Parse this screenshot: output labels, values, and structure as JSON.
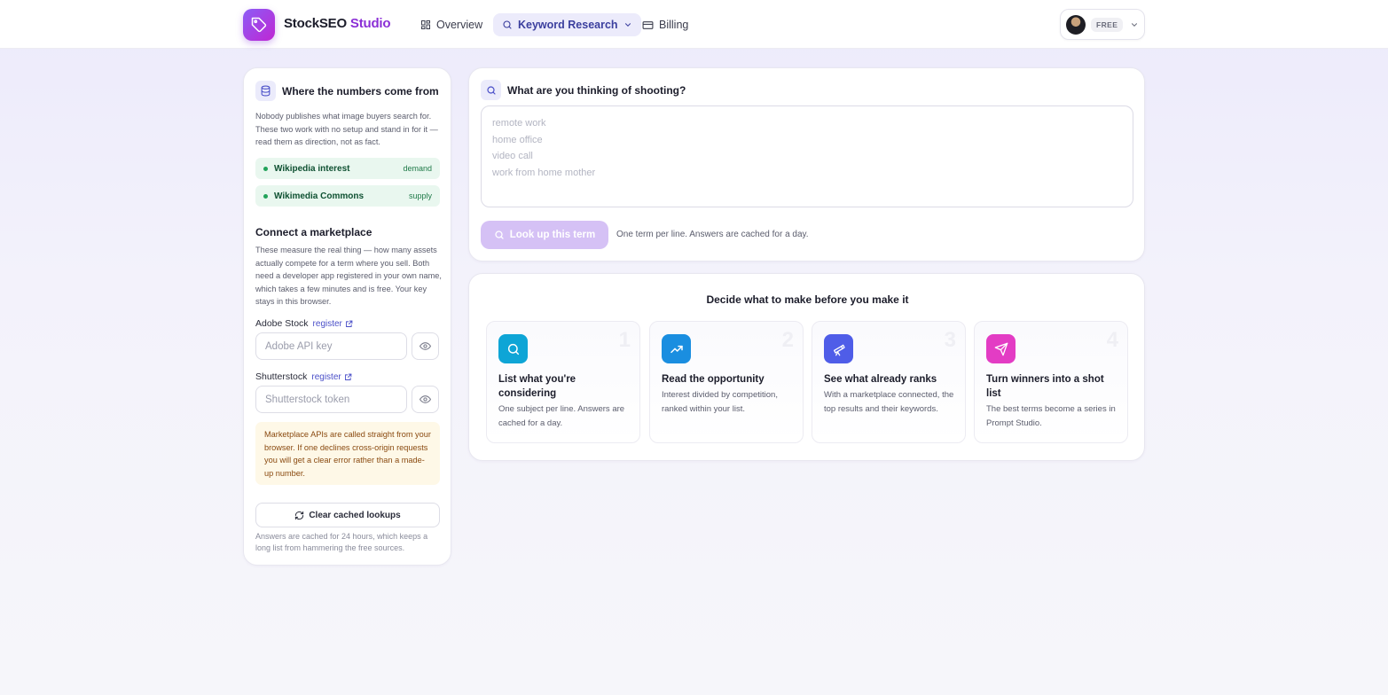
{
  "app": {
    "brand_main": "StockSEO",
    "brand_accent": "Studio",
    "brand_color": "#8b2fd6"
  },
  "nav": {
    "overview": "Overview",
    "keyword_research": "Keyword Research",
    "billing": "Billing"
  },
  "account": {
    "plan": "FREE"
  },
  "sources": {
    "title": "Where the numbers come from",
    "description": "Nobody publishes what image buyers search for. These two work with no setup and stand in for it — read them as direction, not as fact.",
    "items": [
      {
        "name": "Wikipedia interest",
        "tag": "demand"
      },
      {
        "name": "Wikimedia Commons",
        "tag": "supply"
      }
    ]
  },
  "marketplace": {
    "title": "Connect a marketplace",
    "description": "These measure the real thing — how many assets actually compete for a term where you sell. Both need a developer app registered in your own name, which takes a few minutes and is free. Your key stays in this browser.",
    "adobe_label": "Adobe Stock",
    "adobe_register": "register",
    "adobe_placeholder": "Adobe API key",
    "shutterstock_label": "Shutterstock",
    "shutterstock_register": "register",
    "shutterstock_placeholder": "Shutterstock token",
    "warning": "Marketplace APIs are called straight from your browser. If one declines cross-origin requests you will get a clear error rather than a made-up number.",
    "clear_button": "Clear cached lookups",
    "footnote": "Answers are cached for 24 hours, which keeps a long list from hammering the free sources."
  },
  "query": {
    "title": "What are you thinking of shooting?",
    "placeholder": "remote work\nhome office\nvideo call\nwork from home mother",
    "button": "Look up this term",
    "hint": "One term per line. Answers are cached for a day."
  },
  "steps": {
    "title": "Decide what to make before you make it",
    "items": [
      {
        "num": "1",
        "title": "List what you're considering",
        "desc": "One subject per line. Answers are cached for a day.",
        "color": "#0ea5d6",
        "icon": "search-icon"
      },
      {
        "num": "2",
        "title": "Read the opportunity",
        "desc": "Interest divided by competition, ranked within your list.",
        "color": "#1a8ee0",
        "icon": "trending-up-icon"
      },
      {
        "num": "3",
        "title": "See what already ranks",
        "desc": "With a marketplace connected, the top results and their keywords.",
        "color": "#4f5de8",
        "icon": "telescope-icon"
      },
      {
        "num": "4",
        "title": "Turn winners into a shot list",
        "desc": "The best terms become a series in Prompt Studio.",
        "color": "#e33cc4",
        "icon": "send-icon"
      }
    ]
  }
}
